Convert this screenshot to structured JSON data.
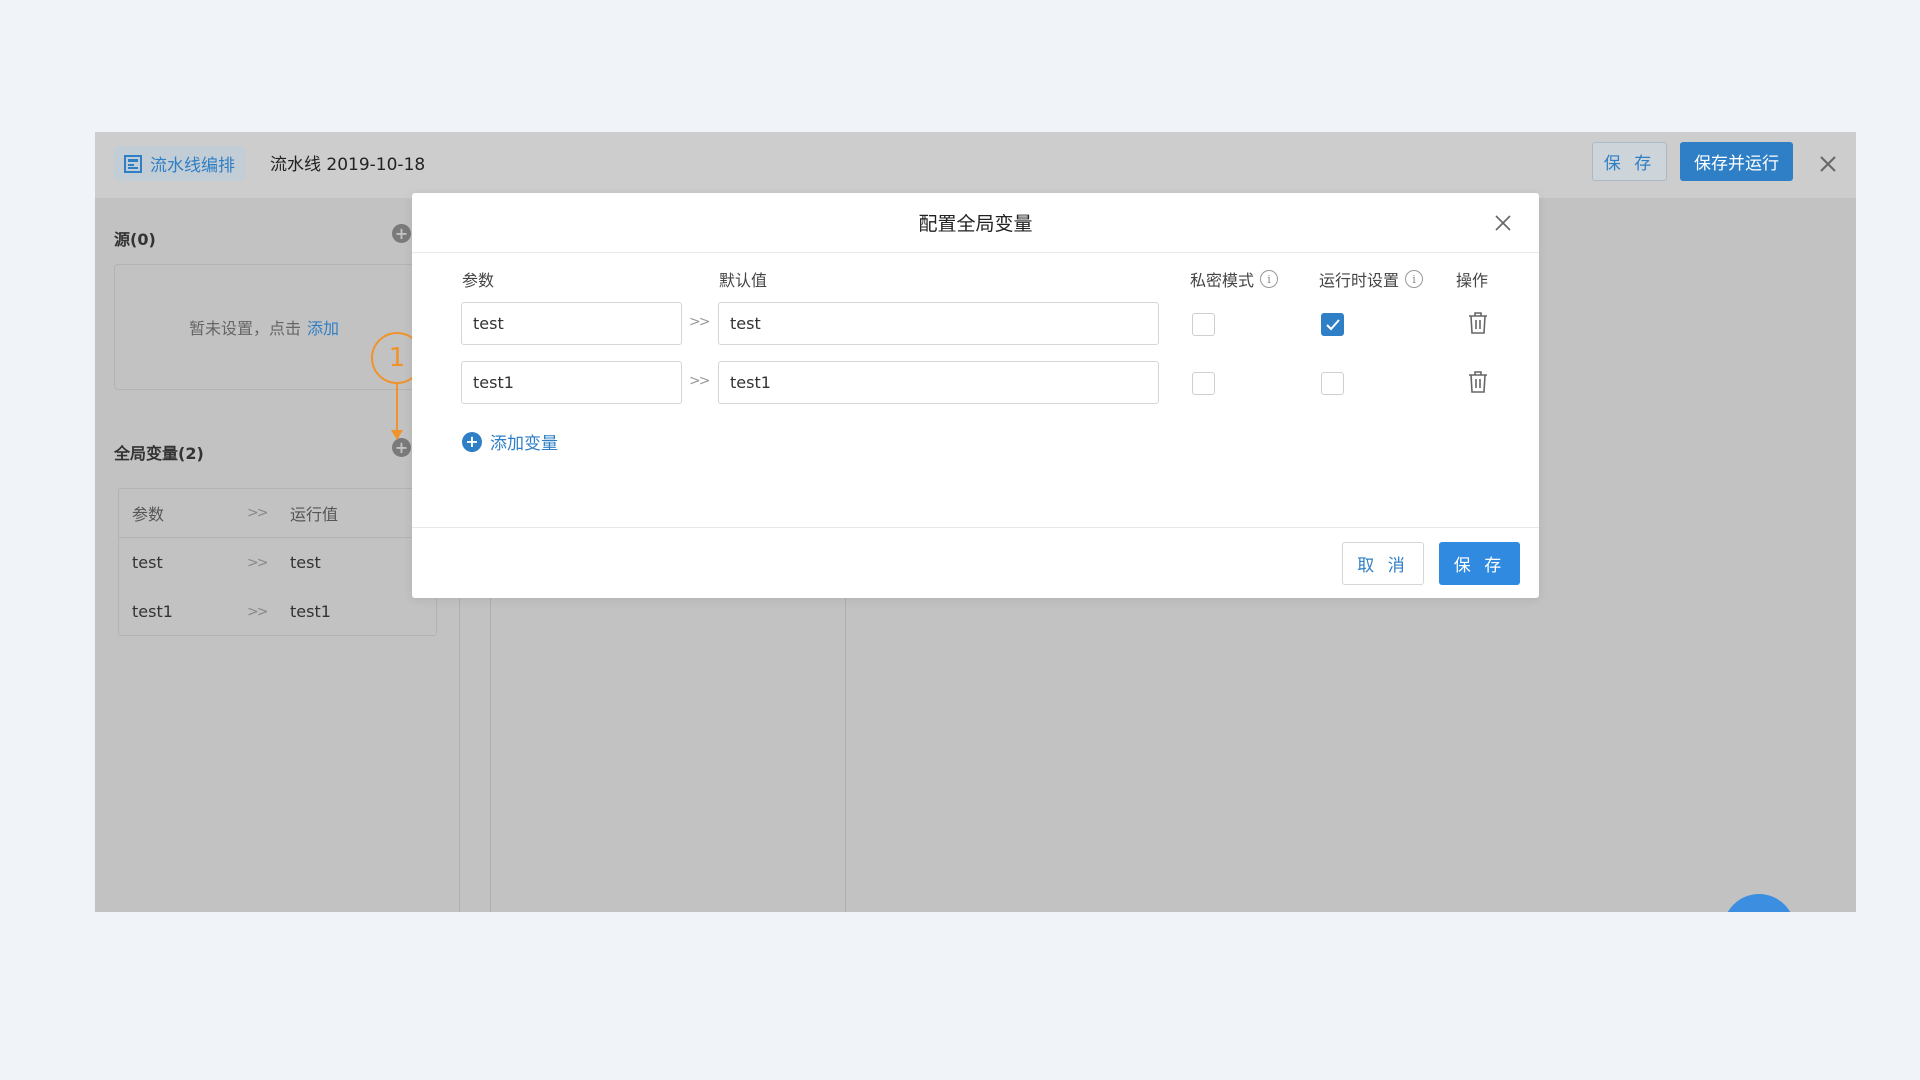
{
  "topbar": {
    "tag_label": "流水线编排",
    "tag_icon": "pipeline-icon",
    "pipeline_title": "流水线 2019-10-18",
    "save_label": "保 存",
    "save_run_label": "保存并运行",
    "close_icon": "close-icon"
  },
  "left_panel": {
    "source_title": "源(0)",
    "source_empty_text": "暂未设置，点击",
    "source_add_link": "添加",
    "globals_title": "全局变量(2)",
    "table": {
      "headers": [
        "参数",
        "运行值"
      ],
      "separator": ">>",
      "rows": [
        {
          "param": "test",
          "value": "test"
        },
        {
          "param": "test1",
          "value": "test1"
        }
      ]
    }
  },
  "annotation": {
    "number": "1",
    "color": "#f0932b"
  },
  "modal": {
    "title": "配置全局变量",
    "columns": {
      "param": "参数",
      "default": "默认值",
      "private": "私密模式",
      "runtime": "运行时设置",
      "action": "操作"
    },
    "separator": ">>",
    "rows": [
      {
        "param": "test",
        "default": "test",
        "private": false,
        "runtime": true
      },
      {
        "param": "test1",
        "default": "test1",
        "private": false,
        "runtime": false
      }
    ],
    "add_variable_label": "添加变量",
    "cancel_label": "取 消",
    "save_label": "保 存"
  },
  "colors": {
    "accent": "#2f7fc6",
    "primary_button": "#2f8ae0",
    "annotation": "#f0932b",
    "overlay_bg": "#c2c2c2"
  }
}
